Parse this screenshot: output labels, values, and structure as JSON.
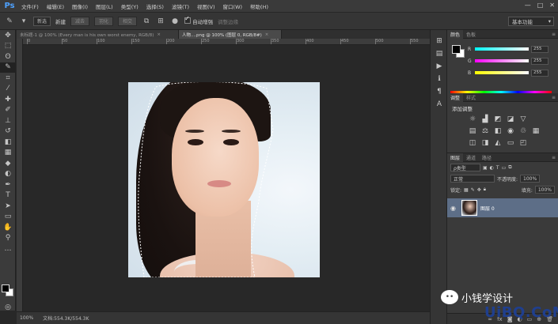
{
  "menubar": {
    "logo": "Ps",
    "items": [
      "文件(F)",
      "编辑(E)",
      "图像(I)",
      "图层(L)",
      "类型(Y)",
      "选择(S)",
      "滤镜(T)",
      "视图(V)",
      "窗口(W)",
      "帮助(H)"
    ],
    "window_controls": [
      "—",
      "□",
      "✕"
    ]
  },
  "options": {
    "mode_value": "新选",
    "feather_label": "羽化",
    "new_btn": "新建",
    "sub_btn": "减去",
    "inter_btn": "相交",
    "auto_label": "自动增强",
    "refine_label": "调整边缘",
    "workspace": "基本功能"
  },
  "tabs": [
    {
      "label": "未标题-1 @ 100% (Every man is his own worst enemy, RGB/8)",
      "active": false
    },
    {
      "label": "人物....png @ 100% (图层 0, RGB/8#)",
      "active": true
    }
  ],
  "rulers": {
    "top_ticks": [
      "0",
      "50",
      "100",
      "150",
      "200",
      "250",
      "300",
      "350",
      "400",
      "450",
      "500",
      "550"
    ]
  },
  "status": {
    "zoom": "100%",
    "doc_info": "文档:554.3K/554.3K"
  },
  "panels": {
    "color_tabs": [
      "颜色",
      "色板"
    ],
    "rgb": [
      {
        "letter": "R",
        "value": "255",
        "gradient": [
          "#00ffff",
          "#ffffff"
        ]
      },
      {
        "letter": "G",
        "value": "255",
        "gradient": [
          "#ff00ff",
          "#ffffff"
        ]
      },
      {
        "letter": "B",
        "value": "255",
        "gradient": [
          "#ffff00",
          "#ffffff"
        ]
      }
    ],
    "adjust_tabs": [
      "调整",
      "样式"
    ],
    "adjust_title": "添加调整",
    "layer_tabs": [
      "图层",
      "通道",
      "路径"
    ],
    "filter_label": "ρ类型",
    "blend_mode": "正常",
    "opacity_label": "不透明度:",
    "opacity_value": "100%",
    "lock_label": "锁定:",
    "fill_label": "填充:",
    "fill_value": "100%",
    "layer_name": "图层 0"
  },
  "watermark": {
    "text": "小钱学设计",
    "site": "UiBQ.CoM"
  }
}
